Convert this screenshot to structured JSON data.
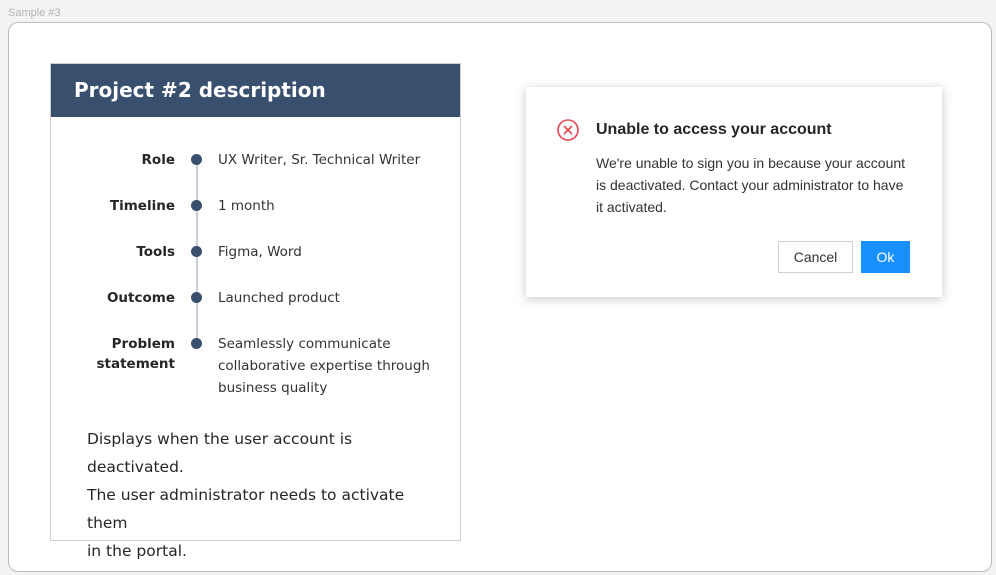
{
  "sample_label": "Sample #3",
  "card": {
    "title": "Project #2 description",
    "rows": [
      {
        "label": "Role",
        "value": "UX Writer, Sr. Technical Writer"
      },
      {
        "label": "Timeline",
        "value": "1 month"
      },
      {
        "label": "Tools",
        "value": "Figma, Word"
      },
      {
        "label": "Outcome",
        "value": "Launched product"
      },
      {
        "label_line1": "Problem",
        "label_line2": "statement",
        "value_line1": "Seamlessly communicate",
        "value_line2": "collaborative expertise through",
        "value_line3": "business quality"
      }
    ],
    "description_line1": "Displays when the user account is deactivated.",
    "description_line2": "The user administrator needs to activate them",
    "description_line3": "in the portal."
  },
  "dialog": {
    "icon": "error-circle-icon",
    "title": "Unable to access your account",
    "message_line1": "We're unable to sign you in because your account",
    "message_line2": "is deactivated. Contact your administrator to have",
    "message_line3": "it activated.",
    "cancel_label": "Cancel",
    "ok_label": "Ok"
  },
  "colors": {
    "header_bg": "#384f6e",
    "error_red": "#e5484d",
    "primary_blue": "#1890ff"
  }
}
